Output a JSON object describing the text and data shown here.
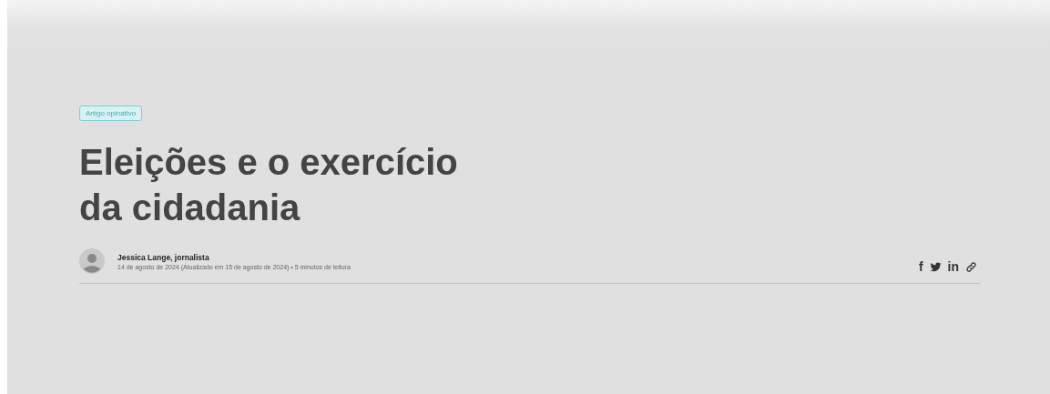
{
  "tag": "Artigo opinativo",
  "title_lines": [
    "Eleições e o exercício",
    "da cidadania"
  ],
  "author": {
    "name": "Jessica Lange, jornalista",
    "meta": "14 de agosto de 2024 (Atualizado em 15 de agosto de 2024) • 5 minutos de leitura"
  },
  "share": [
    {
      "kind": "text",
      "label": "f"
    },
    {
      "kind": "bird"
    },
    {
      "kind": "text",
      "label": "in"
    },
    {
      "kind": "link"
    }
  ]
}
